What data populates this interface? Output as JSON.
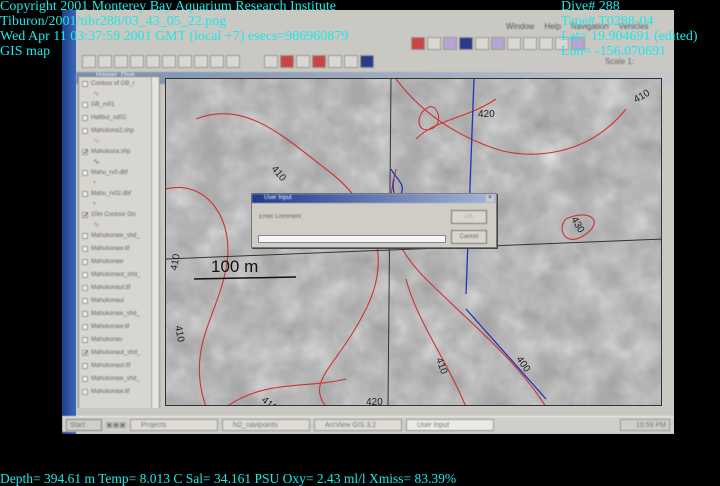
{
  "overlay": {
    "copyright": "Copyright 2001 Monterey Bay Aquarium Research Institute",
    "file": "Tiburon/2001/tibr288/03_43_05_22.png",
    "datetime": "Wed Apr 11 03:37:59 2001 GMT (local +7)  esecs=986960879",
    "mode": "GIS map",
    "dive": "Dive# 288",
    "tape": "Tape# T0288-04",
    "lat": "Lat= 19.904691 (edited)",
    "lon": "Lon= -156.070691",
    "sensors": "Depth= 394.61 m  Temp= 8.013 C  Sal= 34.161 PSU  Oxy= 2.43 ml/l  Xmiss= 83.39%"
  },
  "app": {
    "menu": [
      "Window",
      "Help",
      "Navigation",
      "Vehicles"
    ],
    "scale_label": "Scale 1:",
    "child_title": "Hawaii_Dive"
  },
  "layers": [
    {
      "label": "Contour of GB_r",
      "checked": false,
      "swatch": "∿",
      "color": "#d77"
    },
    {
      "label": "GB_rv01",
      "checked": false
    },
    {
      "label": "Halibut_sd02",
      "checked": false
    },
    {
      "label": "Mahukona2.shp",
      "checked": false,
      "swatch": "∿",
      "color": "#c8c"
    },
    {
      "label": "Mahukona.shp",
      "checked": true,
      "swatch": "∿",
      "color": "#66c"
    },
    {
      "label": "Mahu_rv0.dbf",
      "checked": false,
      "swatch": "•",
      "color": "#c84"
    },
    {
      "label": "Mahu_rv02.dbf",
      "checked": false,
      "swatch": "•",
      "color": "#6a6"
    },
    {
      "label": "10m Contour Dis",
      "checked": true,
      "swatch": "∿",
      "color": "#d77"
    },
    {
      "label": "Mahukonaw_shd_",
      "checked": false
    },
    {
      "label": "Mahukonaw.tif",
      "checked": false
    },
    {
      "label": "Mahukonaw",
      "checked": false
    },
    {
      "label": "Mahukonaut_shd_",
      "checked": false
    },
    {
      "label": "Mahukonaut.tif",
      "checked": false
    },
    {
      "label": "Mahukonaut",
      "checked": false
    },
    {
      "label": "Mahukonaw_shd_",
      "checked": false
    },
    {
      "label": "Mahukonaw.tif",
      "checked": false
    },
    {
      "label": "Mahukonau",
      "checked": false
    },
    {
      "label": "Mahukonaut_shd_",
      "checked": true
    },
    {
      "label": "Mahukonaut.tif",
      "checked": false
    },
    {
      "label": "Mahukonaw_shd_",
      "checked": false
    },
    {
      "label": "Mahukonaw.tif",
      "checked": false
    }
  ],
  "map": {
    "scalebar": "100 m",
    "contours": [
      "410",
      "420",
      "410",
      "430",
      "410",
      "410",
      "410",
      "400",
      "410",
      "420"
    ]
  },
  "dialog": {
    "title": "User Input",
    "label": "Enter Comment",
    "value": "",
    "ok": "OK",
    "cancel": "Cancel"
  },
  "taskbar": {
    "start": "Start",
    "tasks": [
      "Projects",
      "hi2_navipoints",
      "ArcView GIS 3.2",
      "User Input"
    ],
    "clock": "10:59 PM"
  }
}
